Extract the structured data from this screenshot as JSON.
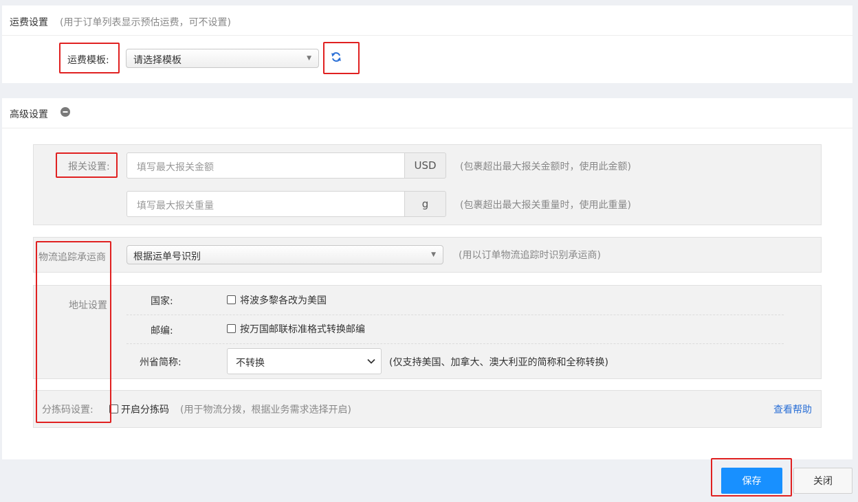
{
  "freight": {
    "title": "运费设置",
    "note": "(用于订单列表显示预估运费，可不设置)",
    "template_label": "运费模板:",
    "template_value": "请选择模板",
    "refresh_icon": "refresh-icon"
  },
  "advanced": {
    "title": "高级设置",
    "collapse_icon": "minus-circle-icon",
    "customs": {
      "label": "报关设置:",
      "amount_placeholder": "填写最大报关金额",
      "amount_unit": "USD",
      "amount_note": "(包裹超出最大报关金额时，使用此金额)",
      "weight_placeholder": "填写最大报关重量",
      "weight_unit": "g",
      "weight_note": "(包裹超出最大报关重量时，使用此重量)"
    },
    "carrier": {
      "label": "物流追踪承运商",
      "value": "根据运单号识别",
      "note": "(用以订单物流追踪时识别承运商)"
    },
    "address": {
      "label": "地址设置",
      "country_label": "国家:",
      "country_option": "将波多黎各改为美国",
      "zip_label": "邮编:",
      "zip_option": "按万国邮联标准格式转换邮编",
      "state_label": "州省简称:",
      "state_value": "不转换",
      "state_note": "(仅支持美国、加拿大、澳大利亚的简称和全称转换)"
    },
    "sorting": {
      "label": "分拣码设置:",
      "option": "开启分拣码",
      "note": "(用于物流分拨，根据业务需求选择开启)",
      "help_link": "查看帮助"
    }
  },
  "footer": {
    "save_label": "保存",
    "close_label": "关闭"
  },
  "colors": {
    "accent": "#1890ff",
    "link": "#2a6fd6",
    "highlight": "#e02020"
  }
}
